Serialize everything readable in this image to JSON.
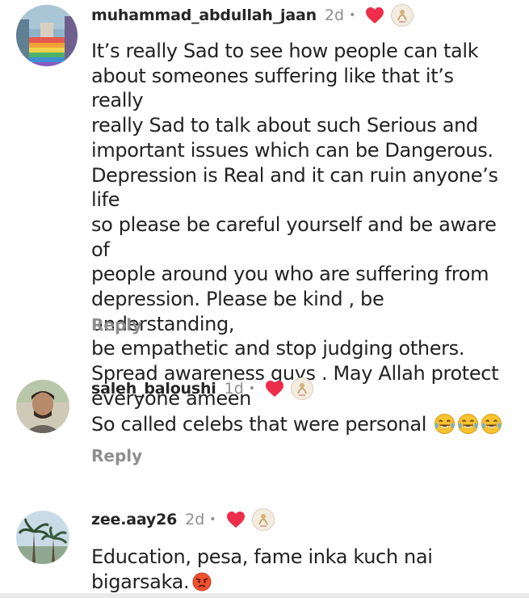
{
  "comments": [
    {
      "username": "muhammad_abdullah_jaan",
      "time": "2d",
      "dot": "•",
      "text": "It’s really Sad to see how people can talk\nabout someones suffering like that it’s really\nreally Sad to talk about such Serious and\nimportant issues which can be Dangerous.\nDepression is Real and it can ruin anyone’s life\nso please be careful yourself and be aware of\npeople around you who are suffering from\ndepression. Please be kind , be understanding,\nbe empathetic and stop judging others.\nSpread awareness guys . May Allah protect\neveryone ameen",
      "reply": "Reply",
      "liked_by_creator_icon": "red-heart-icon"
    },
    {
      "username": "saleh_baloushi",
      "time": "1d",
      "dot": "•",
      "text": "So called celebs that were personal",
      "emoji": "😂😂😂",
      "reply": "Reply",
      "liked_by_creator_icon": "red-heart-icon"
    },
    {
      "username": "zee.aay26",
      "time": "2d",
      "dot": "•",
      "text": "Education, pesa, fame inka kuch nai\nbigarsaka.",
      "emoji": "😡",
      "liked_by_creator_icon": "red-heart-icon"
    }
  ],
  "colors": {
    "heart": "#ed2d49",
    "muted": "#8e8e8e",
    "text": "#262626"
  }
}
